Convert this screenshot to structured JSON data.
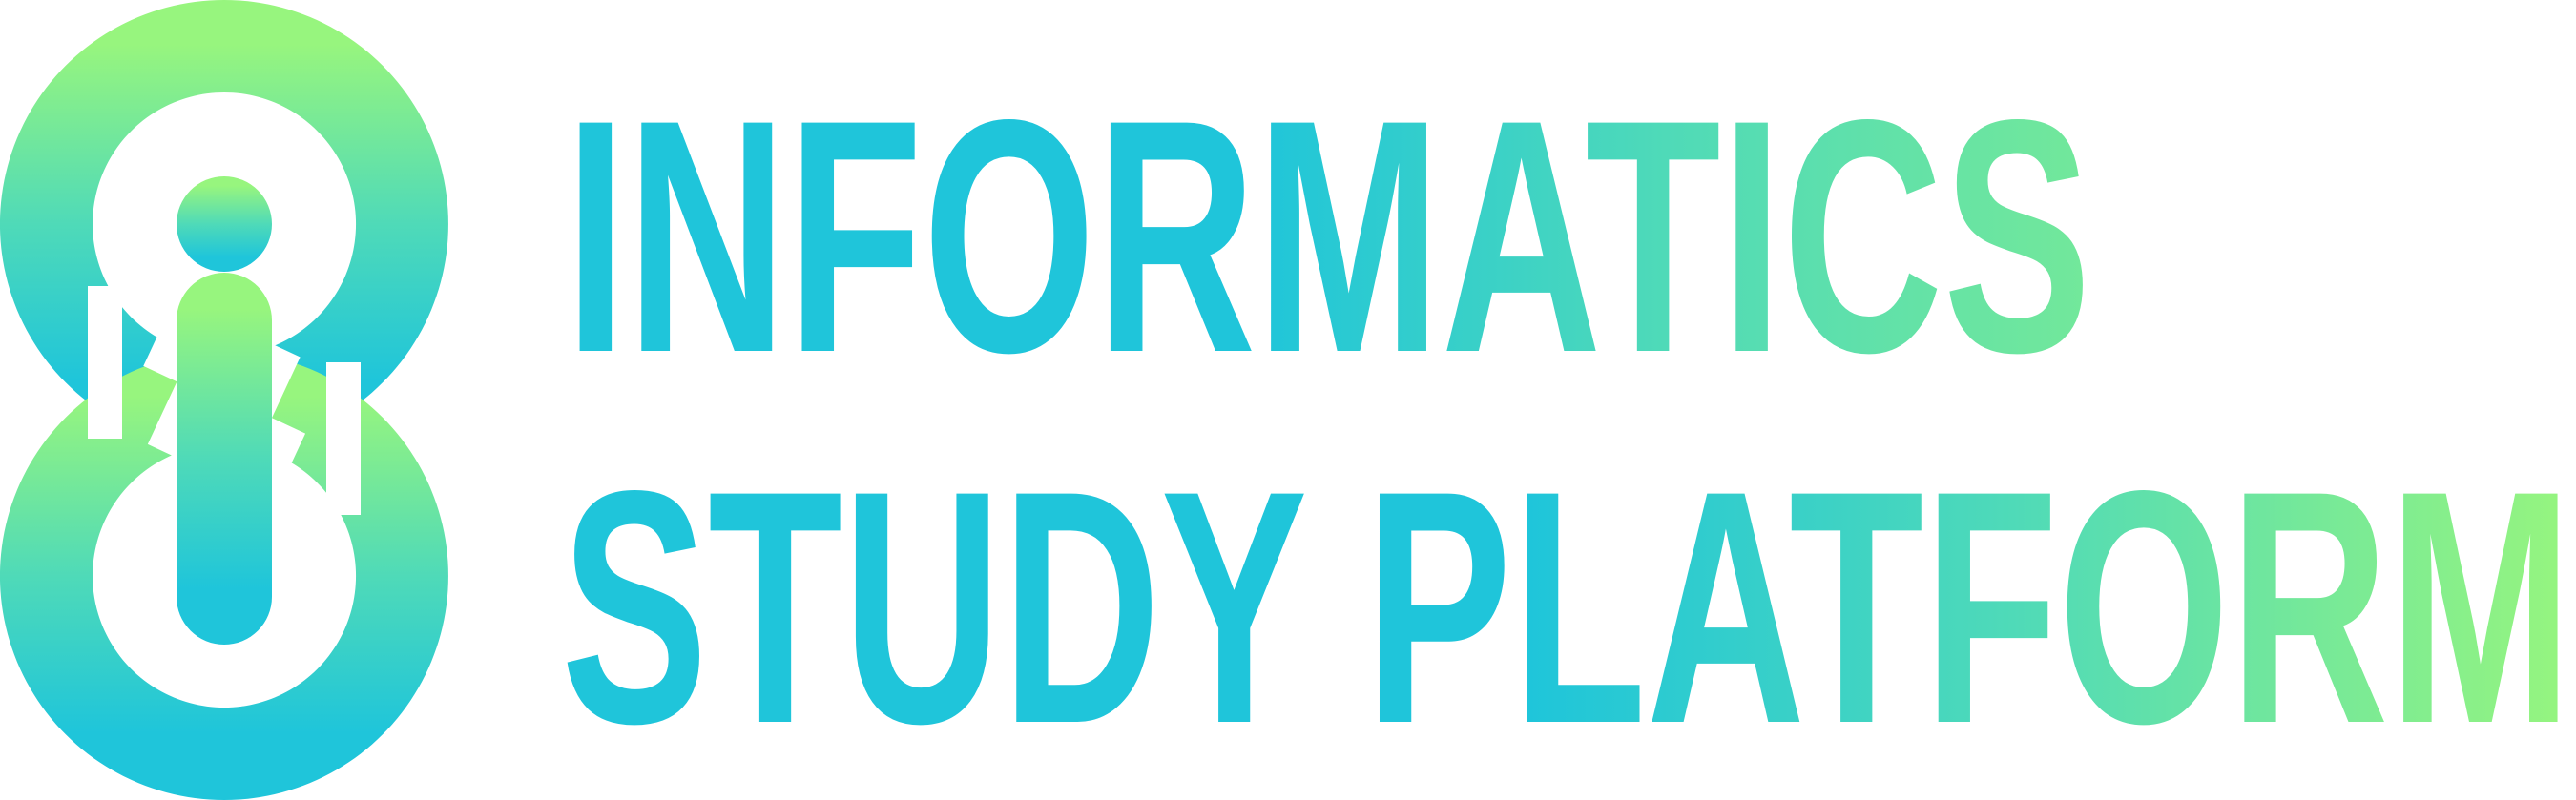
{
  "logo": {
    "line1": "INFORMATICS",
    "line2": "STUDY PLATFORM",
    "colors": {
      "green": "#97F57E",
      "teal": "#4FDAB8",
      "cyan": "#1FC5DA"
    }
  }
}
